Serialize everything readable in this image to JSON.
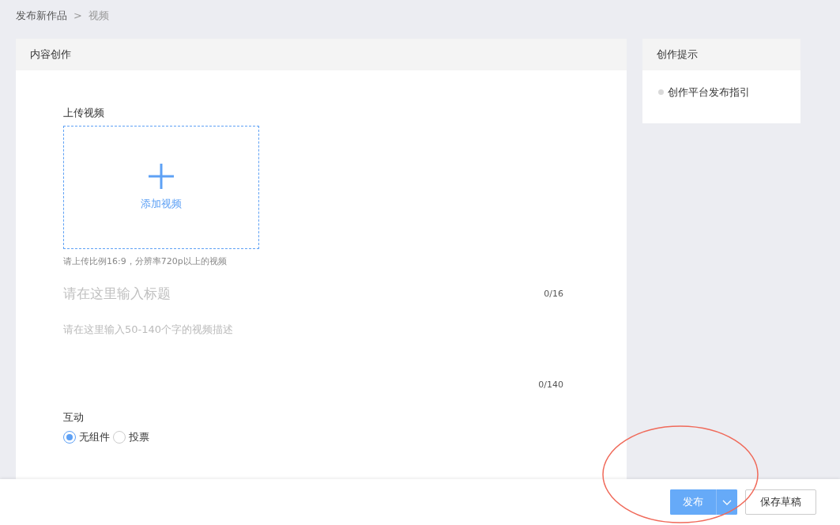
{
  "breadcrumb": {
    "items": [
      {
        "label": "发布新作品",
        "current": false
      },
      {
        "label": "视频",
        "current": true
      }
    ],
    "separator": ">"
  },
  "main_card": {
    "title": "内容创作",
    "upload": {
      "label": "上传视频",
      "button_text": "添加视频",
      "hint": "请上传比例16:9，分辨率720p以上的视频"
    },
    "title_field": {
      "placeholder": "请在这里输入标题",
      "counter": "0/16"
    },
    "description_field": {
      "placeholder": "请在这里输入50-140个字的视频描述",
      "counter": "0/140"
    },
    "interaction": {
      "label": "互动",
      "options": [
        {
          "label": "无组件",
          "selected": true
        },
        {
          "label": "投票",
          "selected": false
        }
      ]
    }
  },
  "tips_card": {
    "title": "创作提示",
    "items": [
      {
        "label": "创作平台发布指引",
        "color": "#d9d9d9"
      }
    ]
  },
  "footer": {
    "publish_button": "发布",
    "save_draft_button": "保存草稿"
  },
  "annotation": {
    "color": "#f06a5a"
  }
}
